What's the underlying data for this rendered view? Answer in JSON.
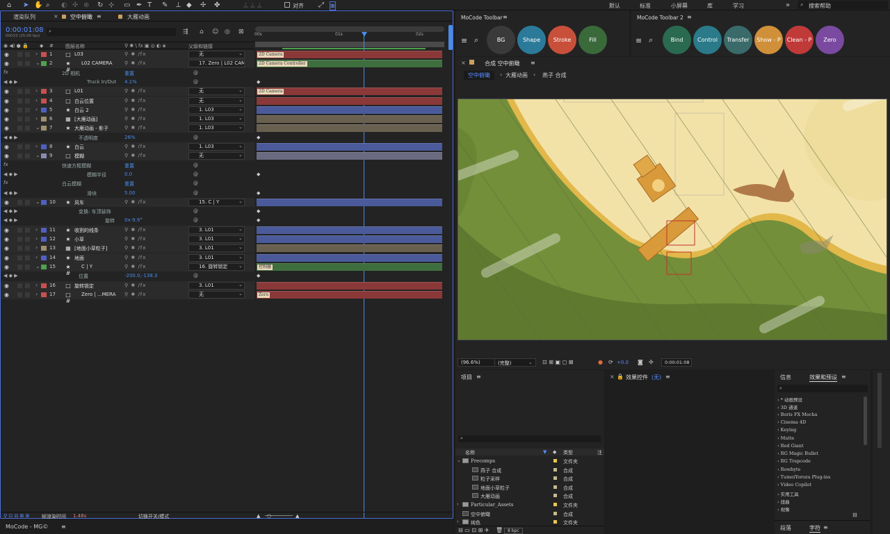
{
  "topbar": {
    "workspaces": [
      "默认",
      "标准",
      "小屏幕",
      "库",
      "学习"
    ],
    "align_label": "对齐",
    "search_placeholder": "搜索帮助"
  },
  "timeline": {
    "tabs": [
      "渲染队列",
      "空中俯瞰",
      "大雁动画"
    ],
    "timecode": "0:00:01:08",
    "frame_info": "00033 (25.00 fps)",
    "col_layer_name": "图层名称",
    "col_parent": "父级和链接",
    "ruler": [
      "00s",
      "01s",
      "02s"
    ],
    "footer_render": "帧渲染时间",
    "footer_time": "1.48s",
    "footer_toggle": "切换开关/模式",
    "rows": [
      {
        "type": "layer",
        "num": "1",
        "name": "L03",
        "color": "#c85050",
        "icon": "□",
        "parent": "无",
        "bar": "#8a3838",
        "tag": "2D Camera"
      },
      {
        "type": "layer",
        "num": "2",
        "name": "L02 CAMERA",
        "color": "#50a050",
        "icon": "★ #",
        "parent": "17. Zero | L02 CAM",
        "bar": "#3e6e3e",
        "tag": "2D Camera Controller",
        "expanded": true
      },
      {
        "type": "prop",
        "name": "2D 相机",
        "val": "重置",
        "indent": 88
      },
      {
        "type": "prop",
        "name": "Truck In/Out",
        "val": "4.1%",
        "indent": 124
      },
      {
        "type": "layer",
        "num": "3",
        "name": "L01",
        "color": "#c85050",
        "icon": "□",
        "parent": "无",
        "bar": "#8a3838",
        "tag": "2D Camera"
      },
      {
        "type": "layer",
        "num": "4",
        "name": "白云位置",
        "color": "#c85050",
        "icon": "□",
        "parent": "无",
        "bar": "#8a3838"
      },
      {
        "type": "layer",
        "num": "5",
        "name": "白云 2",
        "color": "#5060c0",
        "icon": "★",
        "parent": "1. L03",
        "bar": "#4a5a9a"
      },
      {
        "type": "layer",
        "num": "6",
        "name": "[大雁动画]",
        "color": "#a09070",
        "icon": "▦",
        "parent": "1. L03",
        "bar": "#6a6050"
      },
      {
        "type": "layer",
        "num": "7",
        "name": "大雁动画 - 影子",
        "color": "#a09070",
        "icon": "★",
        "parent": "1. L03",
        "bar": "#6a6050",
        "expanded": true
      },
      {
        "type": "prop",
        "name": "不透明度",
        "val": "26%",
        "indent": 112
      },
      {
        "type": "layer",
        "num": "8",
        "name": "白云",
        "color": "#5060c0",
        "icon": "★",
        "parent": "1. L03",
        "bar": "#4a5a9a"
      },
      {
        "type": "layer",
        "num": "9",
        "name": "模糊",
        "color": "#8a8ab0",
        "icon": "□",
        "parent": "无",
        "bar": "#6a6a80",
        "expanded": true
      },
      {
        "type": "prop",
        "name": "快速方框模糊",
        "val": "重置",
        "indent": 88
      },
      {
        "type": "prop",
        "name": "模糊半径",
        "val": "0.0",
        "indent": 124
      },
      {
        "type": "prop",
        "name": "白云模糊",
        "val": "重置",
        "indent": 88
      },
      {
        "type": "prop",
        "name": "滑块",
        "val": "5.00",
        "indent": 124
      },
      {
        "type": "layer",
        "num": "10",
        "name": "风车",
        "color": "#5060c0",
        "icon": "★",
        "parent": "15. C | Y",
        "bar": "#4a5a9a",
        "expanded": true
      },
      {
        "type": "prop",
        "name": "变换: 车顶装饰",
        "val": "",
        "indent": 112
      },
      {
        "type": "prop",
        "name": "旋转",
        "val": "0x-9.9°",
        "indent": 150
      },
      {
        "type": "layer",
        "num": "11",
        "name": "收割的线条",
        "color": "#5060c0",
        "icon": "★",
        "parent": "3. L01",
        "bar": "#4a5a9a"
      },
      {
        "type": "layer",
        "num": "12",
        "name": "小草",
        "color": "#5060c0",
        "icon": "★",
        "parent": "3. L01",
        "bar": "#4a5a9a"
      },
      {
        "type": "layer",
        "num": "13",
        "name": "[地面小草粒子]",
        "color": "#a09070",
        "icon": "▦",
        "parent": "3. L01",
        "bar": "#6a6050"
      },
      {
        "type": "layer",
        "num": "14",
        "name": "地面",
        "color": "#5060c0",
        "icon": "★",
        "parent": "3. L01",
        "bar": "#4a5a9a"
      },
      {
        "type": "layer",
        "num": "15",
        "name": "C | Y",
        "color": "#50a050",
        "icon": "★ #",
        "parent": "16. 旋转锁定",
        "bar": "#3e6e3e",
        "tag": "控制器",
        "expanded": true
      },
      {
        "type": "prop",
        "name": "位置",
        "val": "-200.0,-138.3",
        "indent": 112
      },
      {
        "type": "layer",
        "num": "16",
        "name": "旋转锁定",
        "color": "#c85050",
        "icon": "□",
        "parent": "3. L01",
        "bar": "#8a3838"
      },
      {
        "type": "layer",
        "num": "17",
        "name": "Zero | ...MERA",
        "color": "#c85050",
        "icon": "□ #",
        "parent": "无",
        "bar": "#8a3838",
        "tag": "Zero"
      }
    ]
  },
  "mocode1": {
    "title": "MoCode Toolbar",
    "buttons": [
      {
        "label": "BG",
        "color": "#3a3a3a"
      },
      {
        "label": "Shape",
        "color": "#2b7a9a"
      },
      {
        "label": "Stroke",
        "color": "#c8503a"
      },
      {
        "label": "Fill",
        "color": "#3a6a3a"
      }
    ]
  },
  "mocode2": {
    "title": "MoCode Toolbar 2",
    "buttons": [
      {
        "label": "Bind",
        "color": "#2a6a50"
      },
      {
        "label": "Control",
        "color": "#2a7a8a"
      },
      {
        "label": "Transfer",
        "color": "#3a6a6a"
      },
      {
        "label": "Show - P",
        "color": "#d0903a"
      },
      {
        "label": "Clean - P",
        "color": "#c03a3a"
      },
      {
        "label": "Zero",
        "color": "#7a4aa0"
      }
    ]
  },
  "comp": {
    "title": "合成 空中俯瞰",
    "breadcrumbs": [
      "空中俯瞰",
      "大雁动画",
      "燕子 合成"
    ],
    "zoom": "(96.6%)",
    "quality": "(完整)",
    "exposure": "+0.0",
    "timecode": "0:00:01:08"
  },
  "project": {
    "title": "项目",
    "col_name": "名称",
    "col_type": "类型",
    "col_note": "注",
    "items": [
      {
        "name": "Precomps",
        "type": "文件夹",
        "indent": 0,
        "folder": true
      },
      {
        "name": "燕子 合成",
        "type": "合成",
        "indent": 1
      },
      {
        "name": "粒子采样",
        "type": "合成",
        "indent": 1
      },
      {
        "name": "地面小草粒子",
        "type": "合成",
        "indent": 1
      },
      {
        "name": "大雁动画",
        "type": "合成",
        "indent": 1
      },
      {
        "name": "Particular_Assets",
        "type": "文件夹",
        "indent": 0,
        "folder": true
      },
      {
        "name": "空中俯瞰",
        "type": "合成",
        "indent": 0
      },
      {
        "name": "纯色",
        "type": "文件夹",
        "indent": 0,
        "folder": true
      }
    ],
    "bpc": "8 bpc"
  },
  "effects_controls": {
    "title": "效果控件",
    "sub": "(无)"
  },
  "effects_presets": {
    "tabs": [
      "信息",
      "效果和预设"
    ],
    "items": [
      "* 动画预设",
      "3D 通道",
      "Boris FX Mocha",
      "Cinema 4D",
      "Keying",
      "Matte",
      "Red Giant",
      "RG Magic Bullet",
      "RG Trapcode",
      "Rowbyte",
      "TumoiYorozu Plug-ins",
      "Video Copilot",
      "实用工具",
      "扭曲",
      "视像"
    ],
    "bottom_tabs": [
      "段落",
      "字符"
    ]
  },
  "statusbar": {
    "text": "MoCode - MG©"
  }
}
